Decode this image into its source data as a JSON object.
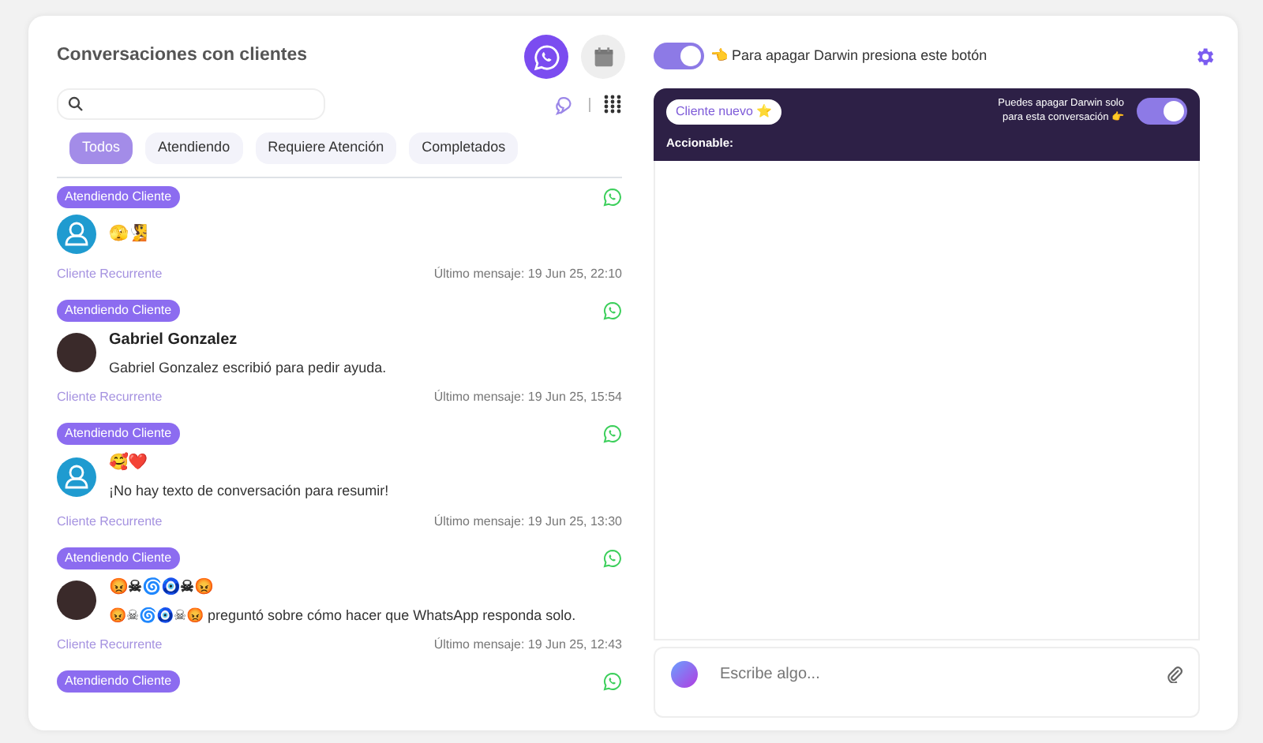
{
  "header": {
    "title": "Conversaciones con clientes",
    "channels": [
      {
        "kind": "whatsapp",
        "selected": true
      },
      {
        "kind": "calendar",
        "selected": false
      }
    ]
  },
  "filters": [
    {
      "label": "Todos",
      "selected": true
    },
    {
      "label": "Atendiendo",
      "selected": false
    },
    {
      "label": "Requiere Atención",
      "selected": false
    },
    {
      "label": "Completados",
      "selected": false
    }
  ],
  "conversations": [
    {
      "status": "Atendiendo Cliente",
      "kind": "default_avatar",
      "name": "🫣🧏",
      "client_type": "Cliente Recurrente",
      "last_message": "Último mensaje: 19 Jun 25, 22:10"
    },
    {
      "status": "Atendiendo Cliente",
      "kind": "photo_avatar",
      "name": "Gabriel Gonzalez",
      "summary": "Gabriel Gonzalez escribió para pedir ayuda.",
      "client_type": "Cliente Recurrente",
      "last_message": "Último mensaje: 19 Jun 25, 15:54"
    },
    {
      "status": "Atendiendo Cliente",
      "kind": "default_avatar",
      "name": "🥰❤️",
      "summary": "¡No hay texto de conversación para resumir!",
      "client_type": "Cliente Recurrente",
      "last_message": "Último mensaje: 19 Jun 25, 13:30"
    },
    {
      "status": "Atendiendo Cliente",
      "kind": "photo_avatar",
      "name": "😡☠🌀🧿☠😡",
      "summary": "😡☠🌀🧿☠😡 preguntó sobre cómo hacer que WhatsApp responda solo.",
      "client_type": "Cliente Recurrente",
      "last_message": "Último mensaje: 19 Jun 25, 12:43"
    },
    {
      "status": "Atendiendo Cliente",
      "kind": "status_only"
    }
  ],
  "darwin": {
    "on": true,
    "hint": "👈 Para apagar Darwin presiona este botón"
  },
  "chat": {
    "client_tag": "Cliente nuevo ⭐",
    "toggle_hint": "Puedes apagar Darwin solo para esta conversación 👉",
    "toggle_on": true,
    "actionable_label": "Accionable:",
    "composer_placeholder": "Escribe algo..."
  }
}
